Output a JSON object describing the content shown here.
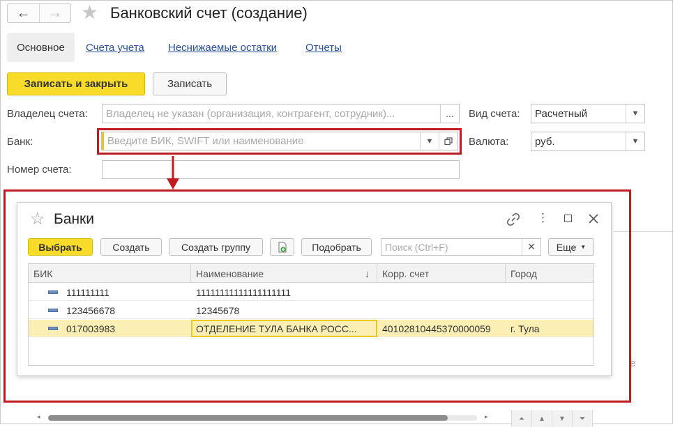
{
  "window": {
    "title": "Банковский счет (создание)"
  },
  "nav": {
    "back_icon": "←",
    "forward_icon": "→"
  },
  "tabs": [
    {
      "label": "Основное",
      "active": true
    },
    {
      "label": "Счета учета"
    },
    {
      "label": "Неснижаемые остатки"
    },
    {
      "label": "Отчеты"
    }
  ],
  "toolbar": {
    "save_close": "Записать и закрыть",
    "save": "Записать"
  },
  "form": {
    "owner_label": "Владелец счета:",
    "owner_placeholder": "Владелец не указан (организация, контрагент, сотрудник)...",
    "owner_btn": "...",
    "bank_label": "Банк:",
    "bank_placeholder": "Введите БИК, SWIFT или наименование",
    "account_label": "Номер счета:",
    "type_label": "Вид счета:",
    "type_value": "Расчетный",
    "currency_label": "Валюта:",
    "currency_value": "руб."
  },
  "right_text": "е",
  "dialog": {
    "title": "Банки",
    "buttons": {
      "select": "Выбрать",
      "create": "Создать",
      "create_group": "Создать группу",
      "pick": "Подобрать",
      "more": "Еще"
    },
    "search_placeholder": "Поиск (Ctrl+F)",
    "columns": [
      "БИК",
      "Наименование",
      "Корр. счет",
      "Город"
    ],
    "sort_indicator": "↓",
    "rows": [
      {
        "bik": "111111111",
        "name": "11111111111111111111",
        "corr": "",
        "city": ""
      },
      {
        "bik": "123456678",
        "name": "12345678",
        "corr": "",
        "city": ""
      },
      {
        "bik": "017003983",
        "name": "ОТДЕЛЕНИЕ ТУЛА БАНКА РОСС...",
        "corr": "40102810445370000059",
        "city": "г. Тула"
      }
    ],
    "selected_row_index": 2
  },
  "colors": {
    "accent_yellow": "#f9dc2a",
    "highlight_red": "#c21a21",
    "link_blue": "#2851a3",
    "row_selected": "#fcefb4"
  }
}
